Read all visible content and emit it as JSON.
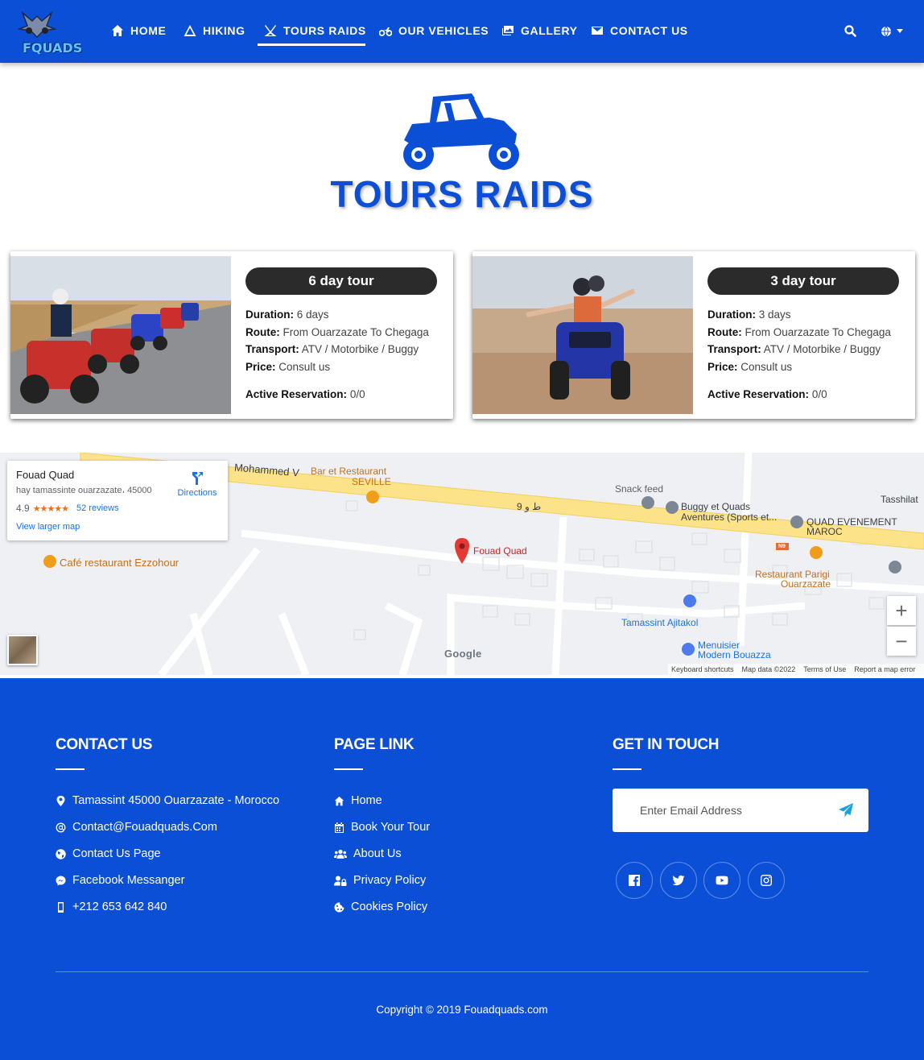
{
  "nav": {
    "logo_text": "FQUADS",
    "items": [
      {
        "label": "HOME",
        "icon": "home-icon"
      },
      {
        "label": "HIKING",
        "icon": "mountain-icon"
      },
      {
        "label": "TOURS RAIDS",
        "icon": "campground-icon",
        "active": true
      },
      {
        "label": "OUR VEHICLES",
        "icon": "motorcycle-icon"
      },
      {
        "label": "GALLERY",
        "icon": "images-icon"
      },
      {
        "label": "CONTACT US",
        "icon": "envelope-icon"
      }
    ],
    "accent": "#0b4fd6"
  },
  "hero": {
    "icon": "buggy-icon",
    "title": "TOURS RAIDS"
  },
  "cards": [
    {
      "tag": "6 day tour",
      "duration_label": "Duration:",
      "duration": "6 days",
      "route_label": "Route:",
      "route": "From Ouarzazate To Chegaga",
      "transport_label": "Transport:",
      "transport": "ATV / Motorbike / Buggy",
      "price_label": "Price:",
      "price": "Consult us",
      "reservation_label": "Active Reservation:",
      "reservation": "0/0"
    },
    {
      "tag": "3 day tour",
      "duration_label": "Duration:",
      "duration": "3 days",
      "route_label": "Route:",
      "route": "From Ouarzazate To Chegaga",
      "transport_label": "Transport:",
      "transport": "ATV / Motorbike / Buggy",
      "price_label": "Price:",
      "price": "Consult us",
      "reservation_label": "Active Reservation:",
      "reservation": "0/0"
    }
  ],
  "map": {
    "place_name": "Fouad Quad",
    "address": "hay tamassinte ouarzazate، 45000",
    "rating": "4.9",
    "stars": "★★★★★",
    "reviews": "52 reviews",
    "larger_map": "View larger map",
    "directions": "Directions",
    "labels": {
      "street": "Mohammed V",
      "bar": "Bar et Restaurant",
      "seville": "SEVILLE",
      "snack": "Snack feed",
      "buggy1": "Buggy et Quads",
      "buggy2": "Aventures (Sports et...",
      "tasshilat": "Tasshilat",
      "quad_ev1": "QUAD EVENEMENT",
      "quad_ev2": "MAROC",
      "fouad": "Fouad Quad",
      "cafe": "Café restaurant Ezzohour",
      "parigi1": "Restaurant Parigi",
      "parigi2": "Ouarzazate",
      "ajitakol": "Tamassint Ajitakol",
      "menuisier1": "Menuisier",
      "menuisier2": "Modern Bouazza",
      "arabic": "ط و 9",
      "n9": "N9",
      "google": "Google"
    },
    "footer": {
      "shortcuts": "Keyboard shortcuts",
      "data": "Map data ©2022",
      "terms": "Terms of Use",
      "report": "Report a map error"
    }
  },
  "footer": {
    "contact_title": "CONTACT US",
    "contact_items": [
      {
        "icon": "map-marker-icon",
        "text": "Tamassint 45000 Ouarzazate - Morocco"
      },
      {
        "icon": "at-icon",
        "text": "Contact@Fouadquads.Com"
      },
      {
        "icon": "globe-icon",
        "text": "Contact Us Page"
      },
      {
        "icon": "messenger-icon",
        "text": "Facebook Messanger"
      },
      {
        "icon": "mobile-icon",
        "text": "+212 653 642 840"
      }
    ],
    "links_title": "PAGE LINK",
    "links": [
      {
        "icon": "home-icon",
        "text": "Home"
      },
      {
        "icon": "calendar-icon",
        "text": "Book Your Tour"
      },
      {
        "icon": "users-icon",
        "text": "About Us"
      },
      {
        "icon": "user-lock-icon",
        "text": "Privacy Policy"
      },
      {
        "icon": "cookie-icon",
        "text": "Cookies Policy"
      }
    ],
    "touch_title": "GET IN TOUCH",
    "email_placeholder": "Enter Email Address",
    "socials": [
      "facebook-icon",
      "twitter-icon",
      "youtube-icon",
      "instagram-icon"
    ],
    "copyright": "Copyright © 2019 Fouadquads.com"
  }
}
